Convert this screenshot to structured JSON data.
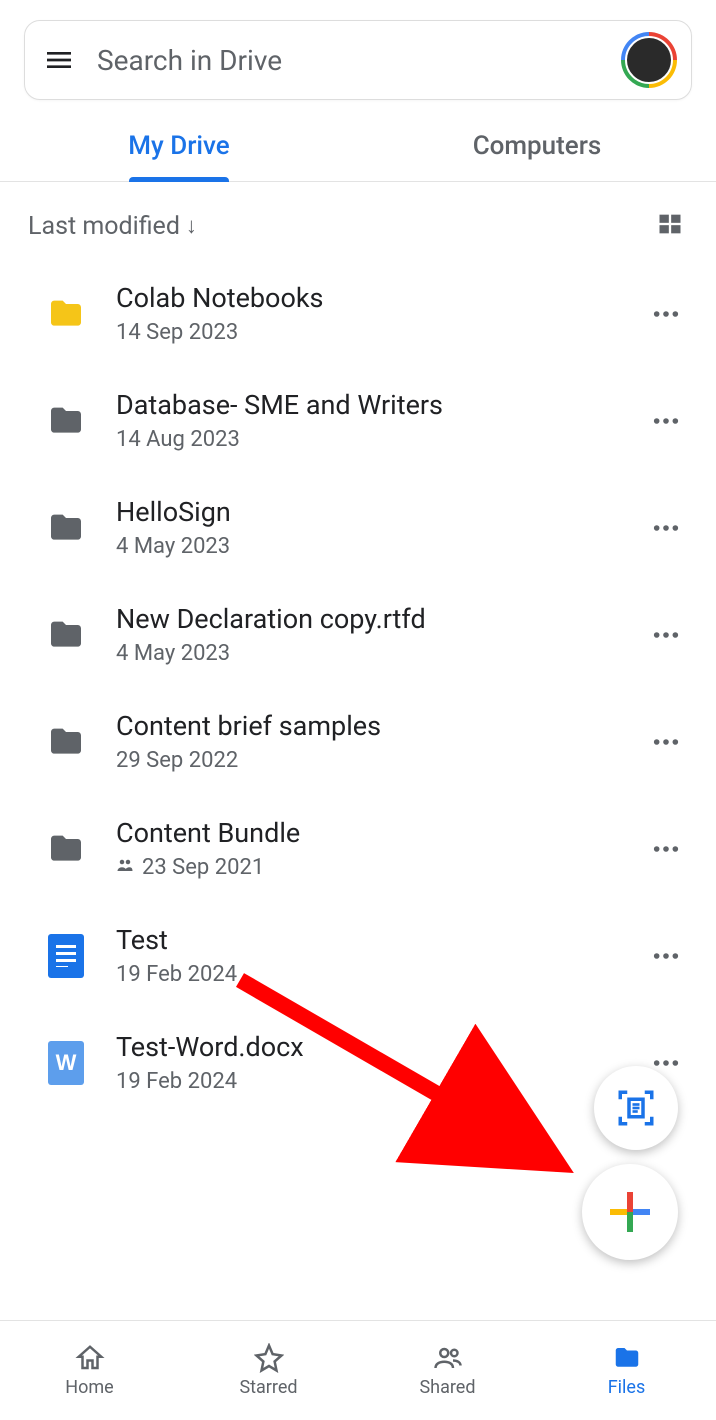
{
  "search": {
    "placeholder": "Search in Drive"
  },
  "tabs": {
    "my_drive": "My Drive",
    "computers": "Computers",
    "active": "my_drive"
  },
  "sort": {
    "label": "Last modified",
    "direction": "down"
  },
  "files": [
    {
      "name": "Colab Notebooks",
      "date": "14 Sep 2023",
      "type": "folder-yellow",
      "shared": false
    },
    {
      "name": "Database- SME and Writers",
      "date": "14 Aug 2023",
      "type": "folder-grey",
      "shared": false
    },
    {
      "name": "HelloSign",
      "date": "4 May 2023",
      "type": "folder-grey",
      "shared": false
    },
    {
      "name": "New Declaration copy.rtfd",
      "date": "4 May 2023",
      "type": "folder-grey",
      "shared": false
    },
    {
      "name": "Content brief samples",
      "date": "29 Sep 2022",
      "type": "folder-grey",
      "shared": false
    },
    {
      "name": "Content Bundle",
      "date": "23 Sep 2021",
      "type": "folder-grey",
      "shared": true
    },
    {
      "name": "Test",
      "date": "19 Feb 2024",
      "type": "docs",
      "shared": false
    },
    {
      "name": "Test-Word.docx",
      "date": "19 Feb 2024",
      "type": "word",
      "shared": false
    }
  ],
  "nav": {
    "home": "Home",
    "starred": "Starred",
    "shared": "Shared",
    "files": "Files",
    "active": "files"
  }
}
